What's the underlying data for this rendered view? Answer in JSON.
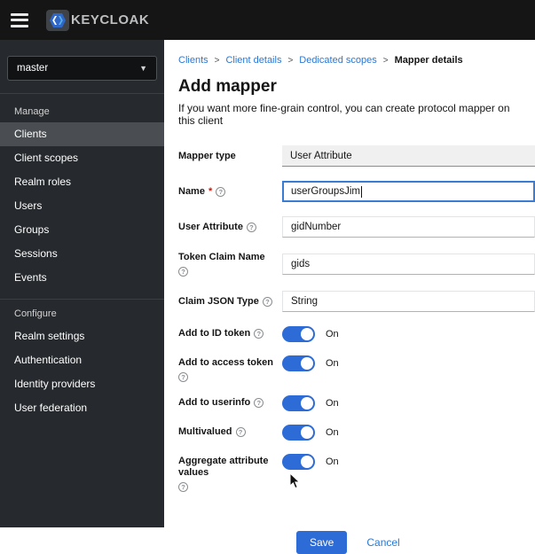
{
  "topbar": {
    "logo_text": "KEYCLOAK"
  },
  "sidebar": {
    "realm": "master",
    "groups": [
      {
        "label": "Manage",
        "items": [
          {
            "label": "Clients",
            "active": true
          },
          {
            "label": "Client scopes"
          },
          {
            "label": "Realm roles"
          },
          {
            "label": "Users"
          },
          {
            "label": "Groups"
          },
          {
            "label": "Sessions"
          },
          {
            "label": "Events"
          }
        ]
      },
      {
        "label": "Configure",
        "items": [
          {
            "label": "Realm settings"
          },
          {
            "label": "Authentication"
          },
          {
            "label": "Identity providers"
          },
          {
            "label": "User federation"
          }
        ]
      }
    ]
  },
  "breadcrumb": {
    "separator": ">",
    "items": [
      "Clients",
      "Client details",
      "Dedicated scopes",
      "Mapper details"
    ]
  },
  "page": {
    "title": "Add mapper",
    "subtitle": "If you want more fine-grain control, you can create protocol mapper on this client"
  },
  "form": {
    "fields": [
      {
        "label": "Mapper type",
        "value": "User Attribute"
      },
      {
        "label": "Name",
        "value": "userGroupsJim"
      },
      {
        "label": "User Attribute",
        "value": "gidNumber"
      },
      {
        "label": "Token Claim Name",
        "value": "gids"
      },
      {
        "label": "Claim JSON Type",
        "value": "String"
      }
    ],
    "toggles": [
      {
        "label": "Add to ID token",
        "state": "On"
      },
      {
        "label": "Add to access token",
        "state": "On"
      },
      {
        "label": "Add to userinfo",
        "state": "On"
      },
      {
        "label": "Multivalued",
        "state": "On"
      },
      {
        "label": "Aggregate attribute values",
        "state": "On"
      }
    ],
    "actions": {
      "save": "Save",
      "cancel": "Cancel"
    }
  },
  "colors": {
    "accent_blue": "#2d6bd6",
    "link_blue": "#2b77d4",
    "topbar_bg": "#151515",
    "sidebar_bg": "#26292d",
    "sidebar_active": "#4a4e52",
    "readonly_bg": "#f0f0f1",
    "required_red": "#c9190b"
  }
}
